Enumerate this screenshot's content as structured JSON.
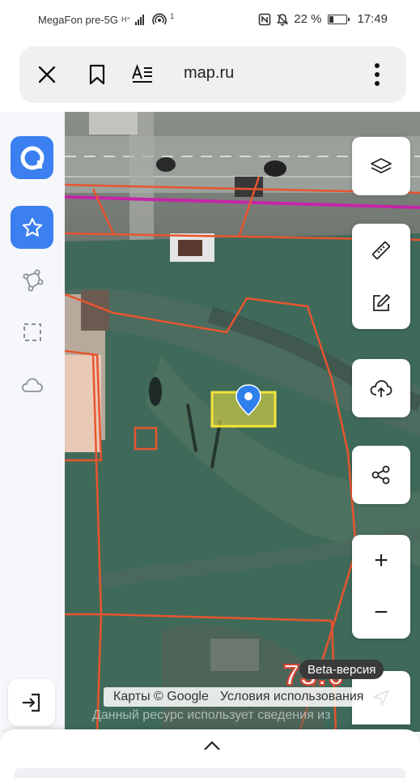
{
  "status_bar": {
    "carrier": "MegaFon pre-5G",
    "network": "H⁺",
    "hotspot": "1",
    "battery": "22 %",
    "battery_level": 0.22,
    "time": "17:49"
  },
  "browser": {
    "url": "map.ru",
    "icons": [
      "close-icon",
      "bookmark-icon",
      "reader-mode-icon",
      "more-vert-icon"
    ]
  },
  "left_rail": {
    "items": [
      "app-logo",
      "favorites-star-icon",
      "polygon-tool-icon",
      "selection-area-icon",
      "cloud-icon",
      "exit-icon"
    ],
    "accent": "#3b7ff0"
  },
  "right_controls": {
    "items": [
      "layers-icon",
      "ruler-icon",
      "edit-icon",
      "upload-icon",
      "share-icon",
      "zoom-in-icon",
      "zoom-out-icon",
      "compass-icon"
    ],
    "zoom_in": "+",
    "zoom_out": "−"
  },
  "map": {
    "beta_label": "Beta-версия",
    "provider": "Карты © Google",
    "terms": "Условия использования",
    "data_source": "Данный ресурс использует сведения из",
    "plot_number": "73:0",
    "plot_highlight": "#f2e43a",
    "boundary_color": "#e8542f",
    "marker_color": "#2f80ed"
  }
}
